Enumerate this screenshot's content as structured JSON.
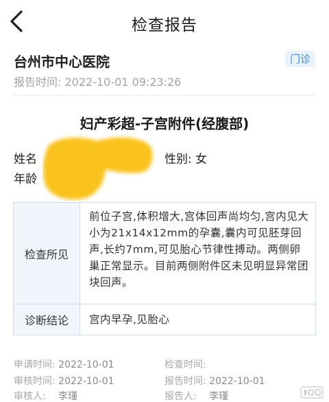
{
  "nav": {
    "title": "检查报告",
    "back_icon": "chevron-left-icon"
  },
  "header": {
    "hospital": "台州市中心医院",
    "badge": "门诊",
    "report_time_label": "报告时间:",
    "report_time_value": "2022-10-01 09:23:26"
  },
  "exam": {
    "title": "妇产彩超-子宫附件(经腹部)"
  },
  "patient": {
    "name_label": "姓名",
    "age_label": "年龄",
    "gender_label": "性别:",
    "gender_value": "女"
  },
  "findings": {
    "label": "检查所见",
    "text": "前位子宫,体积增大,宫体回声尚均匀,宫内见大小为21x14x12mm的孕囊,囊内可见胚芽回声,长约7mm,可见胎心节律性搏动。两侧卵巢正常显示。目前两侧附件区未见明显异常团块回声。"
  },
  "diagnosis": {
    "label": "诊断结论",
    "text": "宫内早孕,见胎心"
  },
  "meta": {
    "apply_time_label": "申请时间:",
    "apply_time_value": "2022-10-01",
    "check_time_label": "检查时间:",
    "check_time_value": "",
    "review_time_label": "审核时间:",
    "review_time_value": "2022-10-01",
    "report_date_label": "报告时间:",
    "report_date_value": "2022-10-01",
    "reviewer_label": "审核人:",
    "reviewer_value": "李瑾",
    "reporter_label": "报告人:",
    "reporter_value": "李瑾"
  },
  "colors": {
    "accent": "#3a86e0",
    "badge_bg": "#eaf3fd",
    "table_head_bg": "#f1f6fc",
    "redaction": "#f9c21a"
  }
}
